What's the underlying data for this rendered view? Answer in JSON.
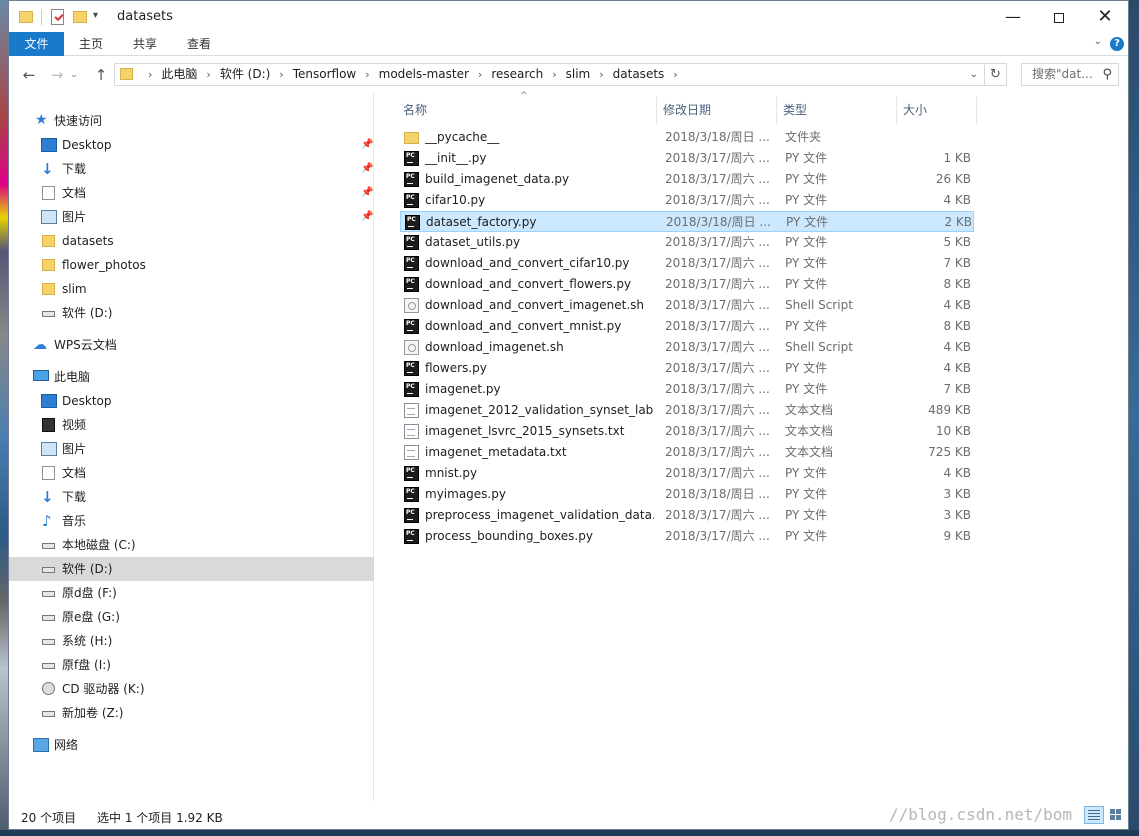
{
  "window": {
    "title": "datasets"
  },
  "quick_access_toolbar": {
    "items": [
      "folder-icon",
      "properties-icon",
      "new-folder-icon"
    ],
    "dropdown": "▾"
  },
  "window_controls": {
    "minimize": "—",
    "maximize": "",
    "close": "✕"
  },
  "ribbon": {
    "tabs": [
      "文件",
      "主页",
      "共享",
      "查看"
    ],
    "expand": "⌄",
    "help": "?"
  },
  "nav_buttons": {
    "back": "←",
    "forward": "→",
    "recent": "⌄",
    "up": "↑"
  },
  "address_bar": {
    "crumbs": [
      "此电脑",
      "软件 (D:)",
      "Tensorflow",
      "models-master",
      "research",
      "slim",
      "datasets"
    ],
    "separator": "›",
    "dropdown": "⌄",
    "refresh": "↻"
  },
  "search": {
    "placeholder": "搜索\"dat...",
    "icon": "⚲"
  },
  "nav_pane": {
    "quick_access": {
      "label": "快速访问",
      "icon": "star-icon"
    },
    "quick_items": [
      {
        "label": "Desktop",
        "icon": "desktop-icon",
        "pinned": true
      },
      {
        "label": "下载",
        "icon": "download-icon",
        "pinned": true
      },
      {
        "label": "文档",
        "icon": "document-icon",
        "pinned": true
      },
      {
        "label": "图片",
        "icon": "pictures-icon",
        "pinned": true
      },
      {
        "label": "datasets",
        "icon": "folder-icon"
      },
      {
        "label": "flower_photos",
        "icon": "folder-icon"
      },
      {
        "label": "slim",
        "icon": "folder-icon"
      },
      {
        "label": "软件 (D:)",
        "icon": "drive-icon"
      }
    ],
    "wps": {
      "label": "WPS云文档",
      "icon": "cloud-icon"
    },
    "this_pc": {
      "label": "此电脑",
      "icon": "computer-icon"
    },
    "pc_items": [
      {
        "label": "Desktop",
        "icon": "desktop-icon"
      },
      {
        "label": "视频",
        "icon": "video-icon"
      },
      {
        "label": "图片",
        "icon": "pictures-icon"
      },
      {
        "label": "文档",
        "icon": "document-icon"
      },
      {
        "label": "下载",
        "icon": "download-icon"
      },
      {
        "label": "音乐",
        "icon": "music-icon"
      },
      {
        "label": "本地磁盘 (C:)",
        "icon": "drive-icon"
      },
      {
        "label": "软件 (D:)",
        "icon": "drive-icon",
        "selected": true
      },
      {
        "label": "原d盘 (F:)",
        "icon": "drive-icon"
      },
      {
        "label": "原e盘 (G:)",
        "icon": "drive-icon"
      },
      {
        "label": "系统 (H:)",
        "icon": "drive-icon"
      },
      {
        "label": "原f盘 (I:)",
        "icon": "drive-icon"
      },
      {
        "label": "CD 驱动器 (K:)",
        "icon": "cd-drive-icon"
      },
      {
        "label": "新加卷 (Z:)",
        "icon": "drive-icon"
      }
    ],
    "network": {
      "label": "网络",
      "icon": "network-icon"
    },
    "pin_glyph": "📌"
  },
  "file_list": {
    "sort_indicator": "^",
    "columns": {
      "name": "名称",
      "date": "修改日期",
      "type": "类型",
      "size": "大小"
    },
    "files": [
      {
        "name": "__pycache__",
        "date": "2018/3/18/周日 ...",
        "type": "文件夹",
        "size": "",
        "icon": "folder"
      },
      {
        "name": "__init__.py",
        "date": "2018/3/17/周六 ...",
        "type": "PY 文件",
        "size": "1 KB",
        "icon": "py"
      },
      {
        "name": "build_imagenet_data.py",
        "date": "2018/3/17/周六 ...",
        "type": "PY 文件",
        "size": "26 KB",
        "icon": "py"
      },
      {
        "name": "cifar10.py",
        "date": "2018/3/17/周六 ...",
        "type": "PY 文件",
        "size": "4 KB",
        "icon": "py"
      },
      {
        "name": "dataset_factory.py",
        "date": "2018/3/18/周日 ...",
        "type": "PY 文件",
        "size": "2 KB",
        "icon": "py",
        "selected": true
      },
      {
        "name": "dataset_utils.py",
        "date": "2018/3/17/周六 ...",
        "type": "PY 文件",
        "size": "5 KB",
        "icon": "py"
      },
      {
        "name": "download_and_convert_cifar10.py",
        "date": "2018/3/17/周六 ...",
        "type": "PY 文件",
        "size": "7 KB",
        "icon": "py"
      },
      {
        "name": "download_and_convert_flowers.py",
        "date": "2018/3/17/周六 ...",
        "type": "PY 文件",
        "size": "8 KB",
        "icon": "py"
      },
      {
        "name": "download_and_convert_imagenet.sh",
        "date": "2018/3/17/周六 ...",
        "type": "Shell Script",
        "size": "4 KB",
        "icon": "sh"
      },
      {
        "name": "download_and_convert_mnist.py",
        "date": "2018/3/17/周六 ...",
        "type": "PY 文件",
        "size": "8 KB",
        "icon": "py"
      },
      {
        "name": "download_imagenet.sh",
        "date": "2018/3/17/周六 ...",
        "type": "Shell Script",
        "size": "4 KB",
        "icon": "sh"
      },
      {
        "name": "flowers.py",
        "date": "2018/3/17/周六 ...",
        "type": "PY 文件",
        "size": "4 KB",
        "icon": "py"
      },
      {
        "name": "imagenet.py",
        "date": "2018/3/17/周六 ...",
        "type": "PY 文件",
        "size": "7 KB",
        "icon": "py"
      },
      {
        "name": "imagenet_2012_validation_synset_lab...",
        "date": "2018/3/17/周六 ...",
        "type": "文本文档",
        "size": "489 KB",
        "icon": "txt"
      },
      {
        "name": "imagenet_lsvrc_2015_synsets.txt",
        "date": "2018/3/17/周六 ...",
        "type": "文本文档",
        "size": "10 KB",
        "icon": "txt"
      },
      {
        "name": "imagenet_metadata.txt",
        "date": "2018/3/17/周六 ...",
        "type": "文本文档",
        "size": "725 KB",
        "icon": "txt"
      },
      {
        "name": "mnist.py",
        "date": "2018/3/17/周六 ...",
        "type": "PY 文件",
        "size": "4 KB",
        "icon": "py"
      },
      {
        "name": "myimages.py",
        "date": "2018/3/18/周日 ...",
        "type": "PY 文件",
        "size": "3 KB",
        "icon": "py"
      },
      {
        "name": "preprocess_imagenet_validation_data...",
        "date": "2018/3/17/周六 ...",
        "type": "PY 文件",
        "size": "3 KB",
        "icon": "py"
      },
      {
        "name": "process_bounding_boxes.py",
        "date": "2018/3/17/周六 ...",
        "type": "PY 文件",
        "size": "9 KB",
        "icon": "py"
      }
    ]
  },
  "status_bar": {
    "item_count": "20 个项目",
    "selection": "选中 1 个项目  1.92 KB",
    "watermark": "//blog.csdn.net/bom"
  }
}
